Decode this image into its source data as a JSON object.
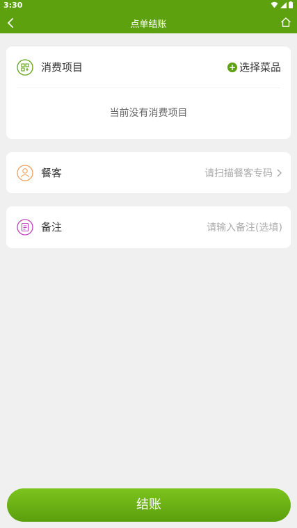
{
  "status_bar": {
    "time": "3:30"
  },
  "nav": {
    "title": "点单结账"
  },
  "items_section": {
    "label": "消费项目",
    "select_label": "选择菜品",
    "empty_text": "当前没有消费项目"
  },
  "guest_section": {
    "label": "餐客",
    "placeholder": "请扫描餐客专码"
  },
  "note_section": {
    "label": "备注",
    "placeholder": "请输入备注(选填)"
  },
  "checkout": {
    "label": "结账"
  },
  "colors": {
    "brand_green": "#5ea10e",
    "guest_icon_orange": "#f0a060",
    "note_icon_purple": "#c040c0"
  }
}
